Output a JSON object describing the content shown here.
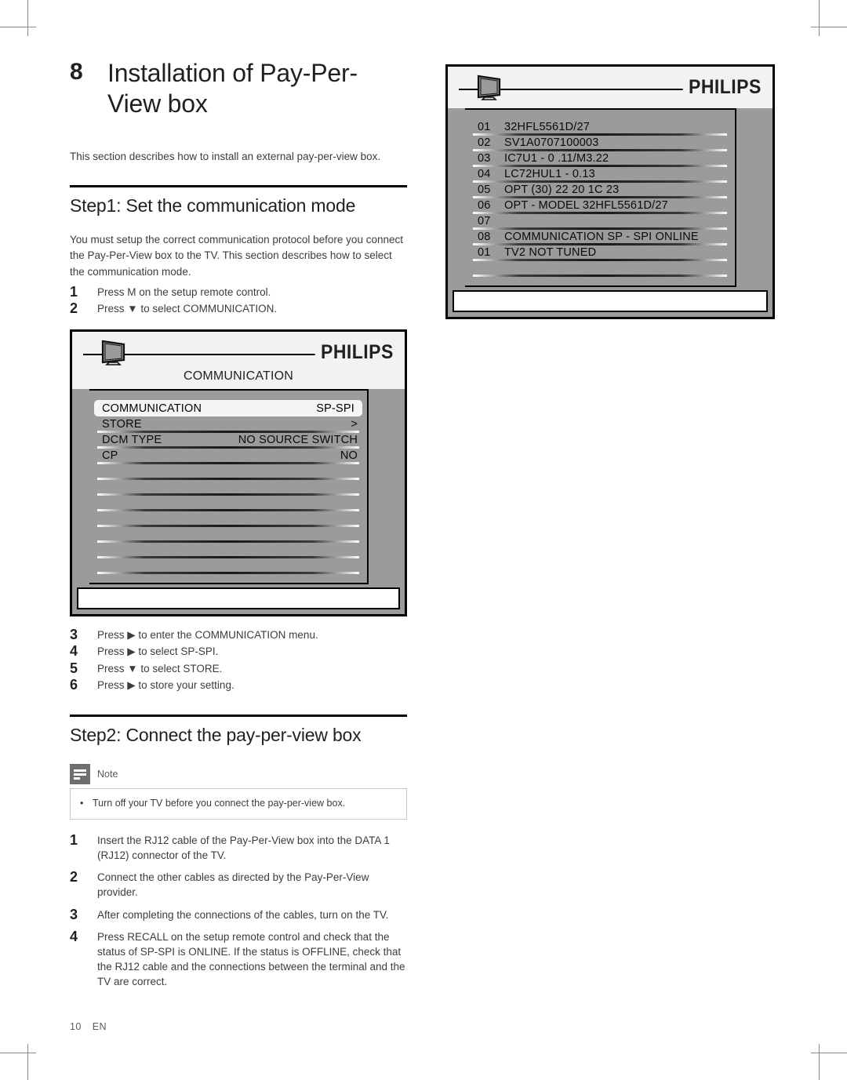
{
  "chapter": {
    "number": "8",
    "title": "Installation of Pay-Per-View box",
    "intro": "This section describes how to install an external pay-per-view box."
  },
  "step1": {
    "heading": "Step1: Set the communication mode",
    "paragraph": "You must setup the correct communication protocol before you connect the Pay-Per-View box to the TV. This section describes how to select the communication mode.",
    "items": [
      {
        "n": "1",
        "text": "Press M on the setup remote control."
      },
      {
        "n": "2",
        "text": "Press ▼ to select COMMUNICATION."
      }
    ],
    "items_after": [
      {
        "n": "3",
        "text": "Press ▶ to enter the COMMUNICATION menu."
      },
      {
        "n": "4",
        "text": "Press ▶ to select SP-SPI."
      },
      {
        "n": "5",
        "text": "Press ▼ to select STORE."
      },
      {
        "n": "6",
        "text": "Press ▶ to store your setting."
      }
    ]
  },
  "step2": {
    "heading": "Step2: Connect the pay-per-view box",
    "note": {
      "label": "Note",
      "bullet_marker": "•",
      "bullet": "Turn off your TV before you connect the pay-per-view box."
    },
    "items": [
      {
        "n": "1",
        "text": "Insert the RJ12 cable of the Pay-Per-View box into the DATA 1 (RJ12) connector of the TV."
      },
      {
        "n": "2",
        "text": "Connect the other cables as directed by the Pay-Per-View provider."
      },
      {
        "n": "3",
        "text": "After completing the connections of the cables, turn on the TV."
      },
      {
        "n": "4",
        "text": "Press RECALL on the setup remote control and check that the status of SP-SPI is ONLINE. If the status is OFFLINE, check that the RJ12 cable and the connections between the terminal and the TV are correct."
      }
    ]
  },
  "osd_communication": {
    "brand": "PHILIPS",
    "icon": "tv-icon",
    "title": "COMMUNICATION",
    "rows": [
      {
        "label": "COMMUNICATION",
        "value": "SP-SPI",
        "selected": true
      },
      {
        "label": "STORE",
        "value": ">",
        "selected": false
      },
      {
        "label": "DCM TYPE",
        "value": "NO SOURCE SWITCH",
        "selected": false
      },
      {
        "label": "CP",
        "value": "NO",
        "selected": false
      }
    ],
    "blank_rows": 7
  },
  "osd_recall": {
    "brand": "PHILIPS",
    "icon": "tv-icon",
    "rows": [
      {
        "num": "01",
        "text": "32HFL5561D/27"
      },
      {
        "num": "02",
        "text": "SV1A0707100003"
      },
      {
        "num": "03",
        "text": "IC7U1 - 0 .11/M3.22"
      },
      {
        "num": "04",
        "text": "LC72HUL1 - 0.13"
      },
      {
        "num": "05",
        "text": "OPT (30) 22 20 1C 23"
      },
      {
        "num": "06",
        "text": "OPT - MODEL  32HFL5561D/27"
      },
      {
        "num": "07",
        "text": ""
      },
      {
        "num": "08",
        "text": "COMMUNICATION SP - SPI ONLINE"
      },
      {
        "num": "01",
        "text": "TV2 NOT TUNED"
      }
    ],
    "blank_rows": 1
  },
  "footer": {
    "page": "10",
    "lang": "EN"
  },
  "colors": {
    "osd_bg": "#9b9b9b",
    "osd_header": "#f2f2f2",
    "note_icon": "#6e6e6e",
    "text": "#231f20",
    "body_text": "#3c3c3c"
  }
}
